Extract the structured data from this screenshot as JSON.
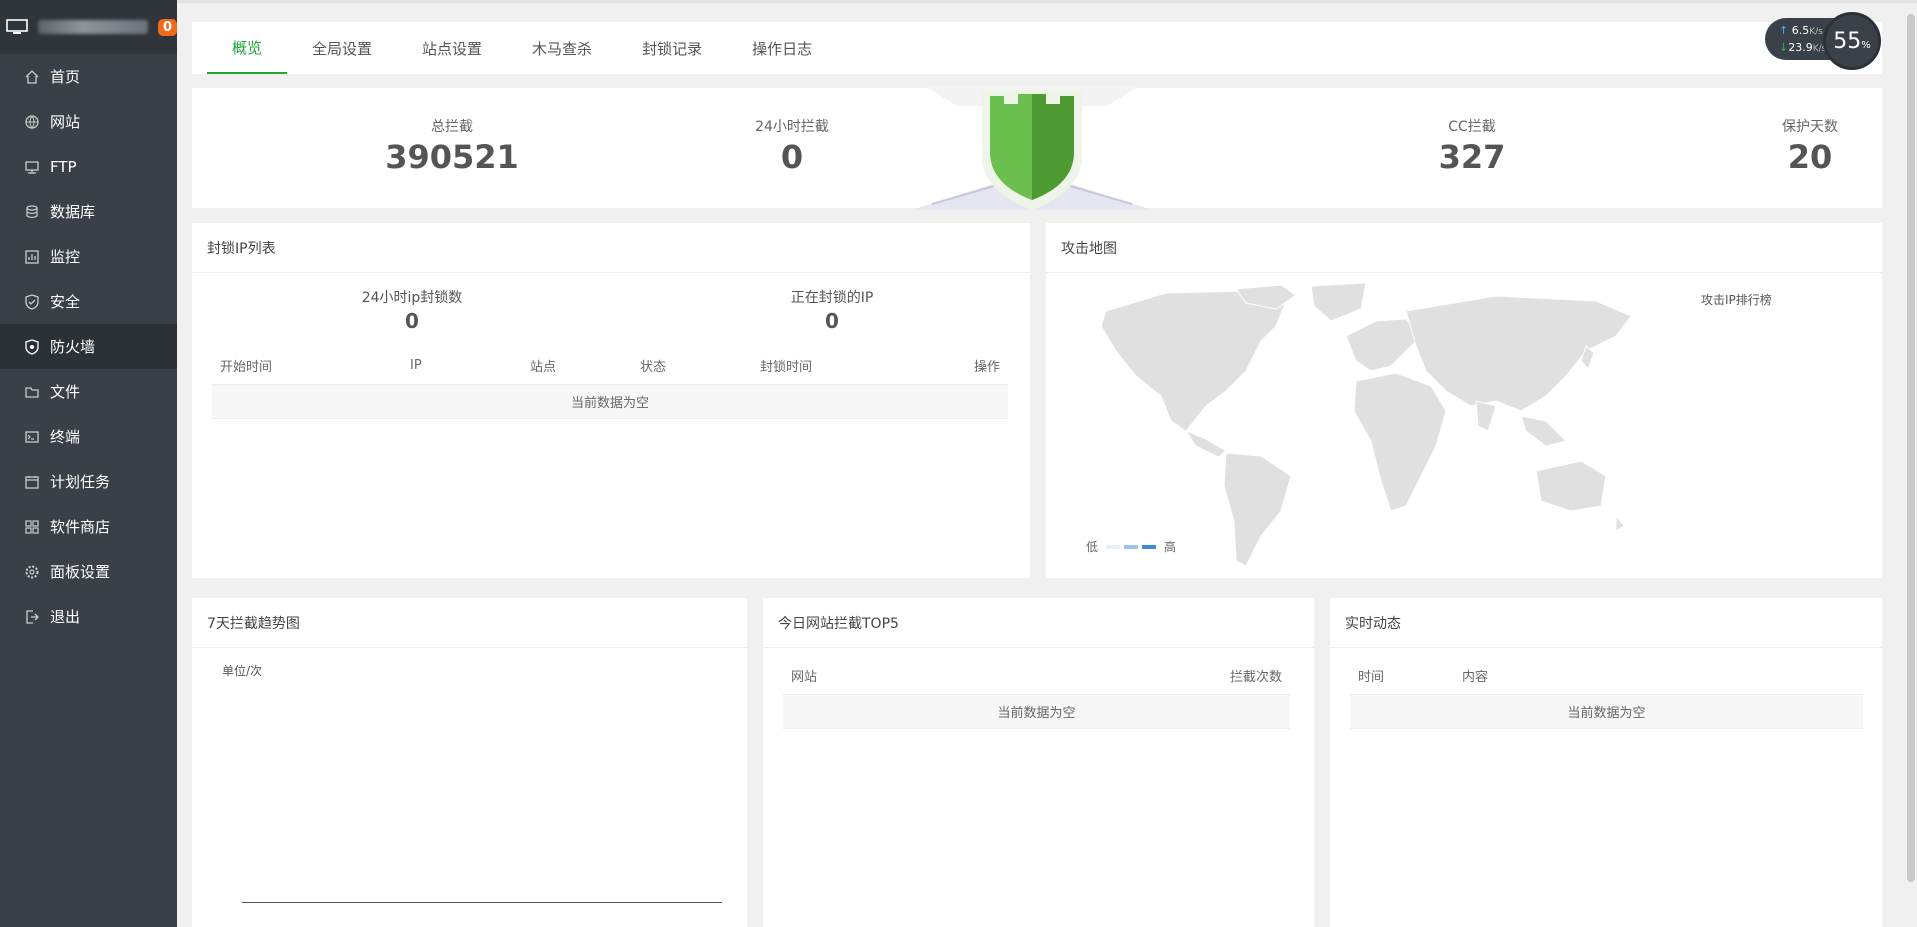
{
  "sidebar": {
    "badge": "0",
    "items": [
      {
        "label": "首页",
        "icon": "home-icon"
      },
      {
        "label": "网站",
        "icon": "globe-icon"
      },
      {
        "label": "FTP",
        "icon": "ftp-icon"
      },
      {
        "label": "数据库",
        "icon": "database-icon"
      },
      {
        "label": "监控",
        "icon": "monitor-icon"
      },
      {
        "label": "安全",
        "icon": "shield-check-icon"
      },
      {
        "label": "防火墙",
        "icon": "firewall-icon"
      },
      {
        "label": "文件",
        "icon": "folder-icon"
      },
      {
        "label": "终端",
        "icon": "terminal-icon"
      },
      {
        "label": "计划任务",
        "icon": "calendar-icon"
      },
      {
        "label": "软件商店",
        "icon": "apps-icon"
      },
      {
        "label": "面板设置",
        "icon": "gear-icon"
      },
      {
        "label": "退出",
        "icon": "logout-icon"
      }
    ],
    "active_index": 6
  },
  "tabs": [
    "概览",
    "全局设置",
    "站点设置",
    "木马查杀",
    "封锁记录",
    "操作日志"
  ],
  "speed": {
    "up": "6.5",
    "up_unit": "K/s",
    "down": "23.9",
    "down_unit": "K/s",
    "load": "55",
    "load_unit": "%"
  },
  "stats": {
    "total": {
      "label": "总拦截",
      "value": "390521"
    },
    "day": {
      "label": "24小时拦截",
      "value": "0"
    },
    "cc": {
      "label": "CC拦截",
      "value": "327"
    },
    "days": {
      "label": "保护天数",
      "value": "20"
    }
  },
  "blocked_ip": {
    "title": "封锁IP列表",
    "count24_label": "24小时ip封锁数",
    "count24_value": "0",
    "blocking_label": "正在封锁的IP",
    "blocking_value": "0",
    "columns": [
      "开始时间",
      "IP",
      "站点",
      "状态",
      "封锁时间",
      "操作"
    ],
    "empty": "当前数据为空"
  },
  "attack_map": {
    "title": "攻击地图",
    "rank": "攻击IP排行榜",
    "legend_low": "低",
    "legend_high": "高",
    "colors": {
      "land": "#e0e0e0",
      "low": "#e8eef7",
      "mid": "#9cc3ea",
      "high": "#3d8bd6"
    }
  },
  "trend": {
    "title": "7天拦截趋势图",
    "unit": "单位/次"
  },
  "top5": {
    "title": "今日网站拦截TOP5",
    "columns": [
      "网站",
      "拦截次数"
    ],
    "empty": "当前数据为空"
  },
  "realtime": {
    "title": "实时动态",
    "columns": [
      "时间",
      "内容"
    ],
    "empty": "当前数据为空"
  },
  "colors": {
    "accent": "#20a53a",
    "sidebar": "#394047",
    "badge": "#ef6a1f"
  }
}
